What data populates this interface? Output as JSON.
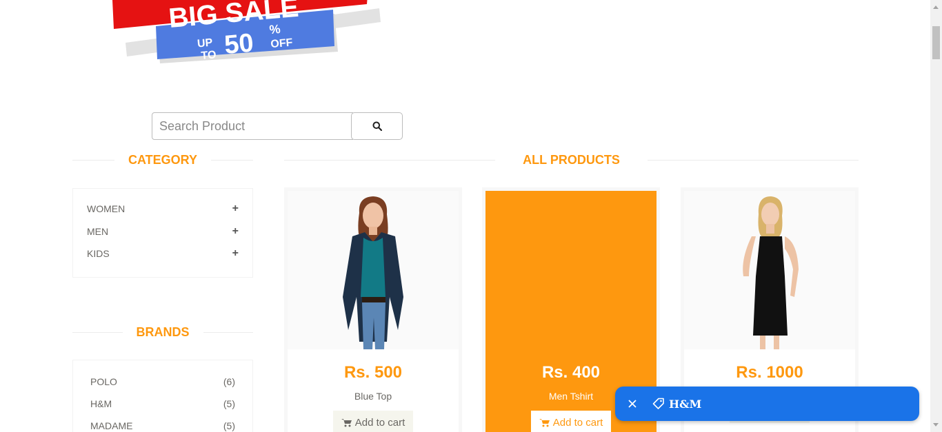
{
  "banner": {
    "line1": "BIG SALE",
    "up": "UP",
    "to": "TO",
    "percent": "50",
    "percent_sign": "%",
    "off": "OFF"
  },
  "search": {
    "placeholder": "Search Product",
    "value": ""
  },
  "category": {
    "title": "CATEGORY",
    "items": [
      {
        "label": "WOMEN",
        "expander": "+"
      },
      {
        "label": "MEN",
        "expander": "+"
      },
      {
        "label": "KIDS",
        "expander": "+"
      }
    ]
  },
  "brands": {
    "title": "BRANDS",
    "items": [
      {
        "label": "POLO",
        "count": "(6)"
      },
      {
        "label": "H&M",
        "count": "(5)"
      },
      {
        "label": "MADAME",
        "count": "(5)"
      }
    ]
  },
  "products": {
    "title": "ALL PRODUCTS",
    "add_to_cart": "Add to cart",
    "items": [
      {
        "price": "Rs. 500",
        "name": "Blue Top"
      },
      {
        "price": "Rs. 400",
        "name": "Men Tshirt"
      },
      {
        "price": "Rs. 1000",
        "name": ""
      }
    ]
  },
  "toast": {
    "label": "H&M"
  },
  "colors": {
    "accent": "#FE980F",
    "toast": "#1a73e8",
    "cart_bg": "#F5F5ED"
  }
}
